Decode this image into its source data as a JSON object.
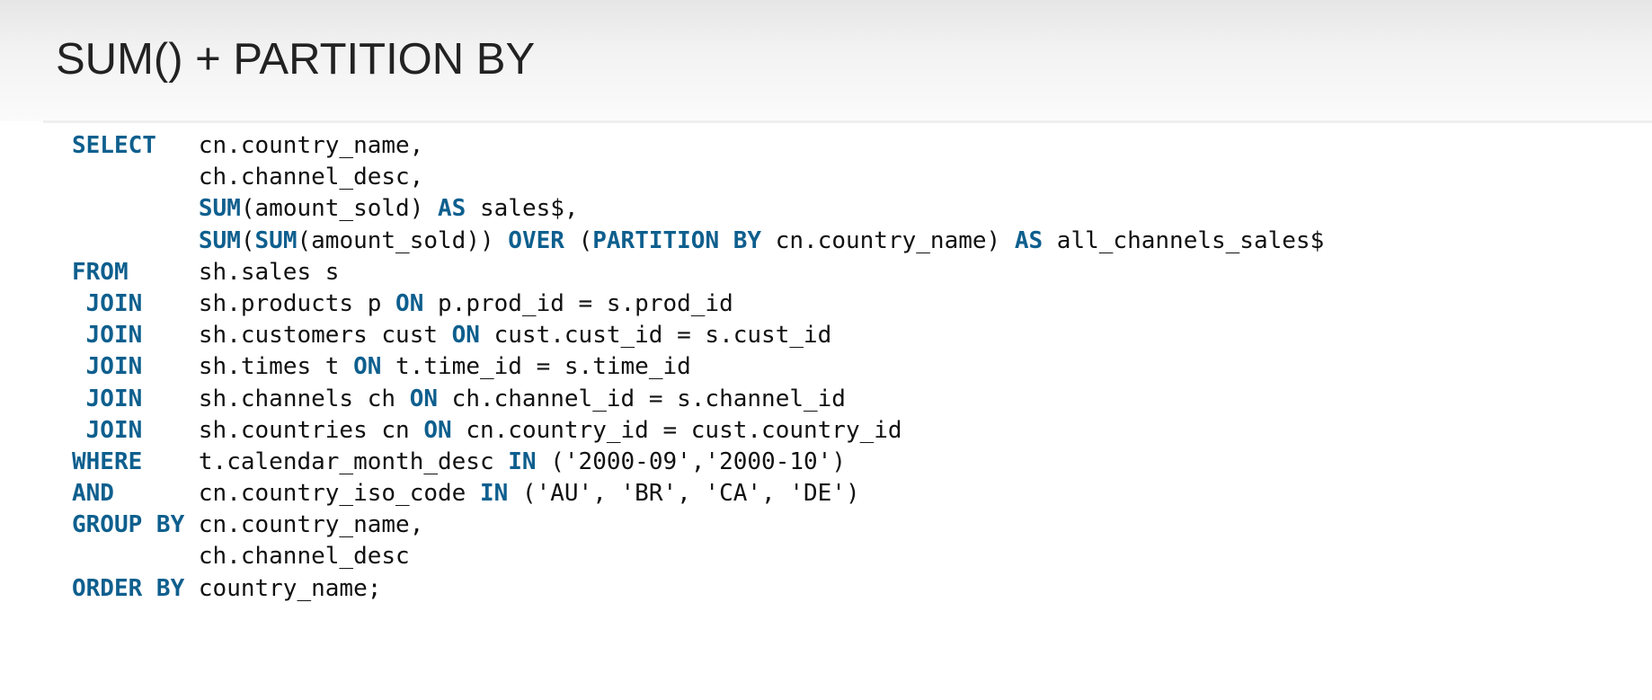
{
  "slide": {
    "title": "SUM() + PARTITION BY"
  },
  "colors": {
    "keyword": "#0e5f8e",
    "text": "#111111",
    "title": "#222222"
  },
  "code": {
    "lines": [
      [
        {
          "t": "SELECT",
          "k": "kw"
        },
        {
          "t": "   cn.country_name,",
          "k": "tx"
        }
      ],
      [
        {
          "t": "         ch.channel_desc,",
          "k": "tx"
        }
      ],
      [
        {
          "t": "         ",
          "k": "tx"
        },
        {
          "t": "SUM",
          "k": "fn"
        },
        {
          "t": "(amount_sold) ",
          "k": "tx"
        },
        {
          "t": "AS",
          "k": "kw"
        },
        {
          "t": " sales$,",
          "k": "tx"
        }
      ],
      [
        {
          "t": "         ",
          "k": "tx"
        },
        {
          "t": "SUM",
          "k": "fn"
        },
        {
          "t": "(",
          "k": "tx"
        },
        {
          "t": "SUM",
          "k": "fn"
        },
        {
          "t": "(amount_sold)) ",
          "k": "tx"
        },
        {
          "t": "OVER",
          "k": "kw"
        },
        {
          "t": " (",
          "k": "tx"
        },
        {
          "t": "PARTITION BY",
          "k": "kw"
        },
        {
          "t": " cn.country_name) ",
          "k": "tx"
        },
        {
          "t": "AS",
          "k": "kw"
        },
        {
          "t": " all_channels_sales$",
          "k": "tx"
        }
      ],
      [
        {
          "t": "FROM",
          "k": "kw"
        },
        {
          "t": "     sh.sales s",
          "k": "tx"
        }
      ],
      [
        {
          "t": " ",
          "k": "tx"
        },
        {
          "t": "JOIN",
          "k": "kw"
        },
        {
          "t": "    sh.products p ",
          "k": "tx"
        },
        {
          "t": "ON",
          "k": "kw"
        },
        {
          "t": " p.prod_id = s.prod_id",
          "k": "tx"
        }
      ],
      [
        {
          "t": " ",
          "k": "tx"
        },
        {
          "t": "JOIN",
          "k": "kw"
        },
        {
          "t": "    sh.customers cust ",
          "k": "tx"
        },
        {
          "t": "ON",
          "k": "kw"
        },
        {
          "t": " cust.cust_id = s.cust_id",
          "k": "tx"
        }
      ],
      [
        {
          "t": " ",
          "k": "tx"
        },
        {
          "t": "JOIN",
          "k": "kw"
        },
        {
          "t": "    sh.times t ",
          "k": "tx"
        },
        {
          "t": "ON",
          "k": "kw"
        },
        {
          "t": " t.time_id = s.time_id",
          "k": "tx"
        }
      ],
      [
        {
          "t": " ",
          "k": "tx"
        },
        {
          "t": "JOIN",
          "k": "kw"
        },
        {
          "t": "    sh.channels ch ",
          "k": "tx"
        },
        {
          "t": "ON",
          "k": "kw"
        },
        {
          "t": " ch.channel_id = s.channel_id",
          "k": "tx"
        }
      ],
      [
        {
          "t": " ",
          "k": "tx"
        },
        {
          "t": "JOIN",
          "k": "kw"
        },
        {
          "t": "    sh.countries cn ",
          "k": "tx"
        },
        {
          "t": "ON",
          "k": "kw"
        },
        {
          "t": " cn.country_id = cust.country_id",
          "k": "tx"
        }
      ],
      [
        {
          "t": "WHERE",
          "k": "kw"
        },
        {
          "t": "    t.calendar_month_desc ",
          "k": "tx"
        },
        {
          "t": "IN",
          "k": "kw"
        },
        {
          "t": " ('2000-09','2000-10')",
          "k": "tx"
        }
      ],
      [
        {
          "t": "AND",
          "k": "kw"
        },
        {
          "t": "      cn.country_iso_code ",
          "k": "tx"
        },
        {
          "t": "IN",
          "k": "kw"
        },
        {
          "t": " ('AU', 'BR', 'CA', 'DE')",
          "k": "tx"
        }
      ],
      [
        {
          "t": "GROUP BY",
          "k": "kw"
        },
        {
          "t": " cn.country_name,",
          "k": "tx"
        }
      ],
      [
        {
          "t": "         ch.channel_desc",
          "k": "tx"
        }
      ],
      [
        {
          "t": "ORDER BY",
          "k": "kw"
        },
        {
          "t": " country_name;",
          "k": "tx"
        }
      ]
    ]
  }
}
